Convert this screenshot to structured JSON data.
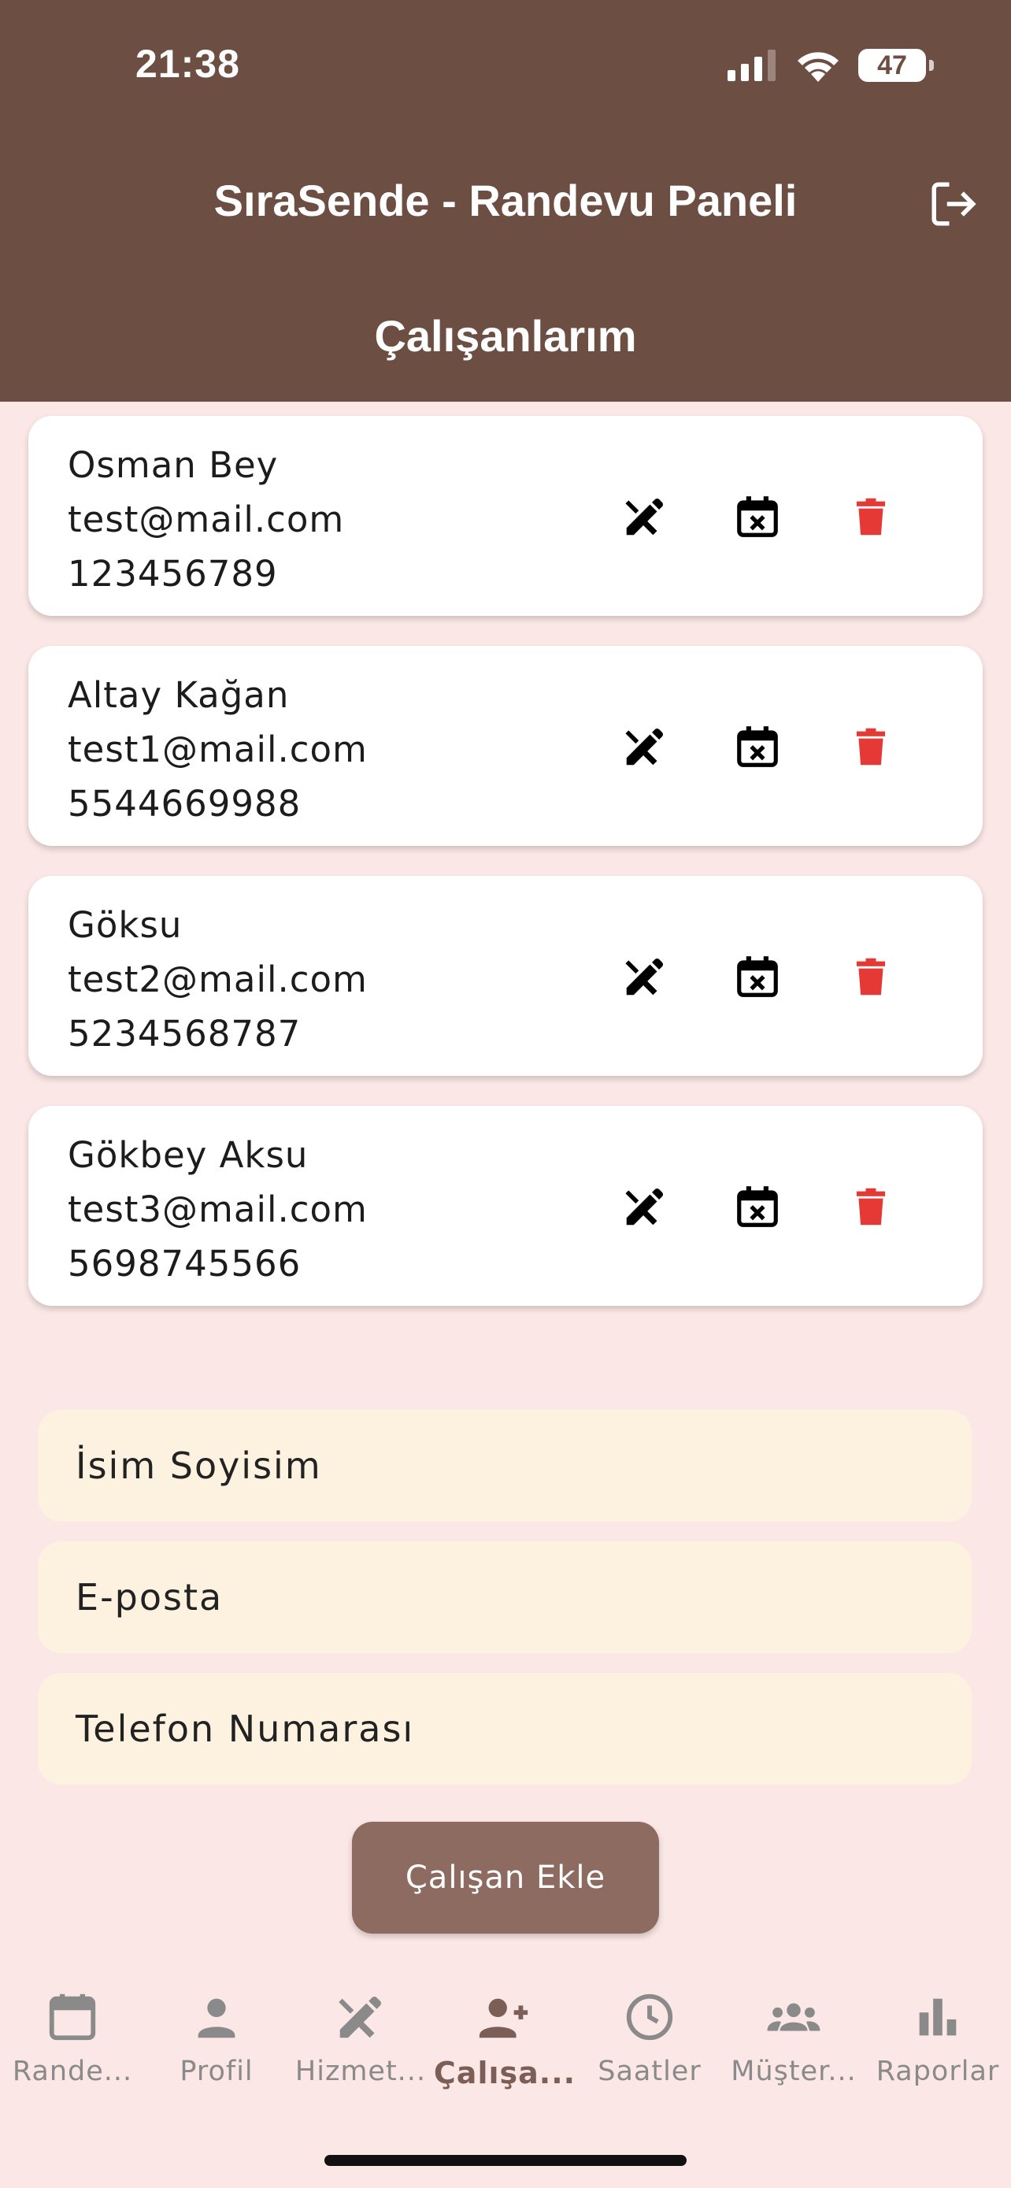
{
  "status": {
    "time": "21:38",
    "battery": "47"
  },
  "appbar": {
    "title": "SıraSende - Randevu Paneli",
    "section_title": "Çalışanlarım"
  },
  "employees": [
    {
      "name": "Osman Bey",
      "email": "test@mail.com",
      "phone": "123456789"
    },
    {
      "name": "Altay Kağan",
      "email": "test1@mail.com",
      "phone": "5544669988"
    },
    {
      "name": "Göksu",
      "email": "test2@mail.com",
      "phone": "5234568787"
    },
    {
      "name": "Gökbey Aksu",
      "email": "test3@mail.com",
      "phone": "5698745566"
    }
  ],
  "form": {
    "name_placeholder": "İsim Soyisim",
    "email_placeholder": "E-posta",
    "phone_placeholder": "Telefon Numarası",
    "submit_label": "Çalışan Ekle"
  },
  "nav": {
    "items": [
      {
        "label": "Rande...",
        "icon": "calendar-icon"
      },
      {
        "label": "Profil",
        "icon": "person-icon"
      },
      {
        "label": "Hizmet...",
        "icon": "tools-icon"
      },
      {
        "label": "Çalışa...",
        "icon": "person-add-icon",
        "active": true
      },
      {
        "label": "Saatler",
        "icon": "clock-icon"
      },
      {
        "label": "Müşter...",
        "icon": "group-icon"
      },
      {
        "label": "Raporlar",
        "icon": "bar-chart-icon"
      }
    ]
  },
  "colors": {
    "appbar": "#6d4e43",
    "background": "#fbe8e6",
    "field": "#fdf1e0",
    "button": "#8d6b61",
    "delete": "#e53935",
    "nav_active": "#7b5e56"
  }
}
